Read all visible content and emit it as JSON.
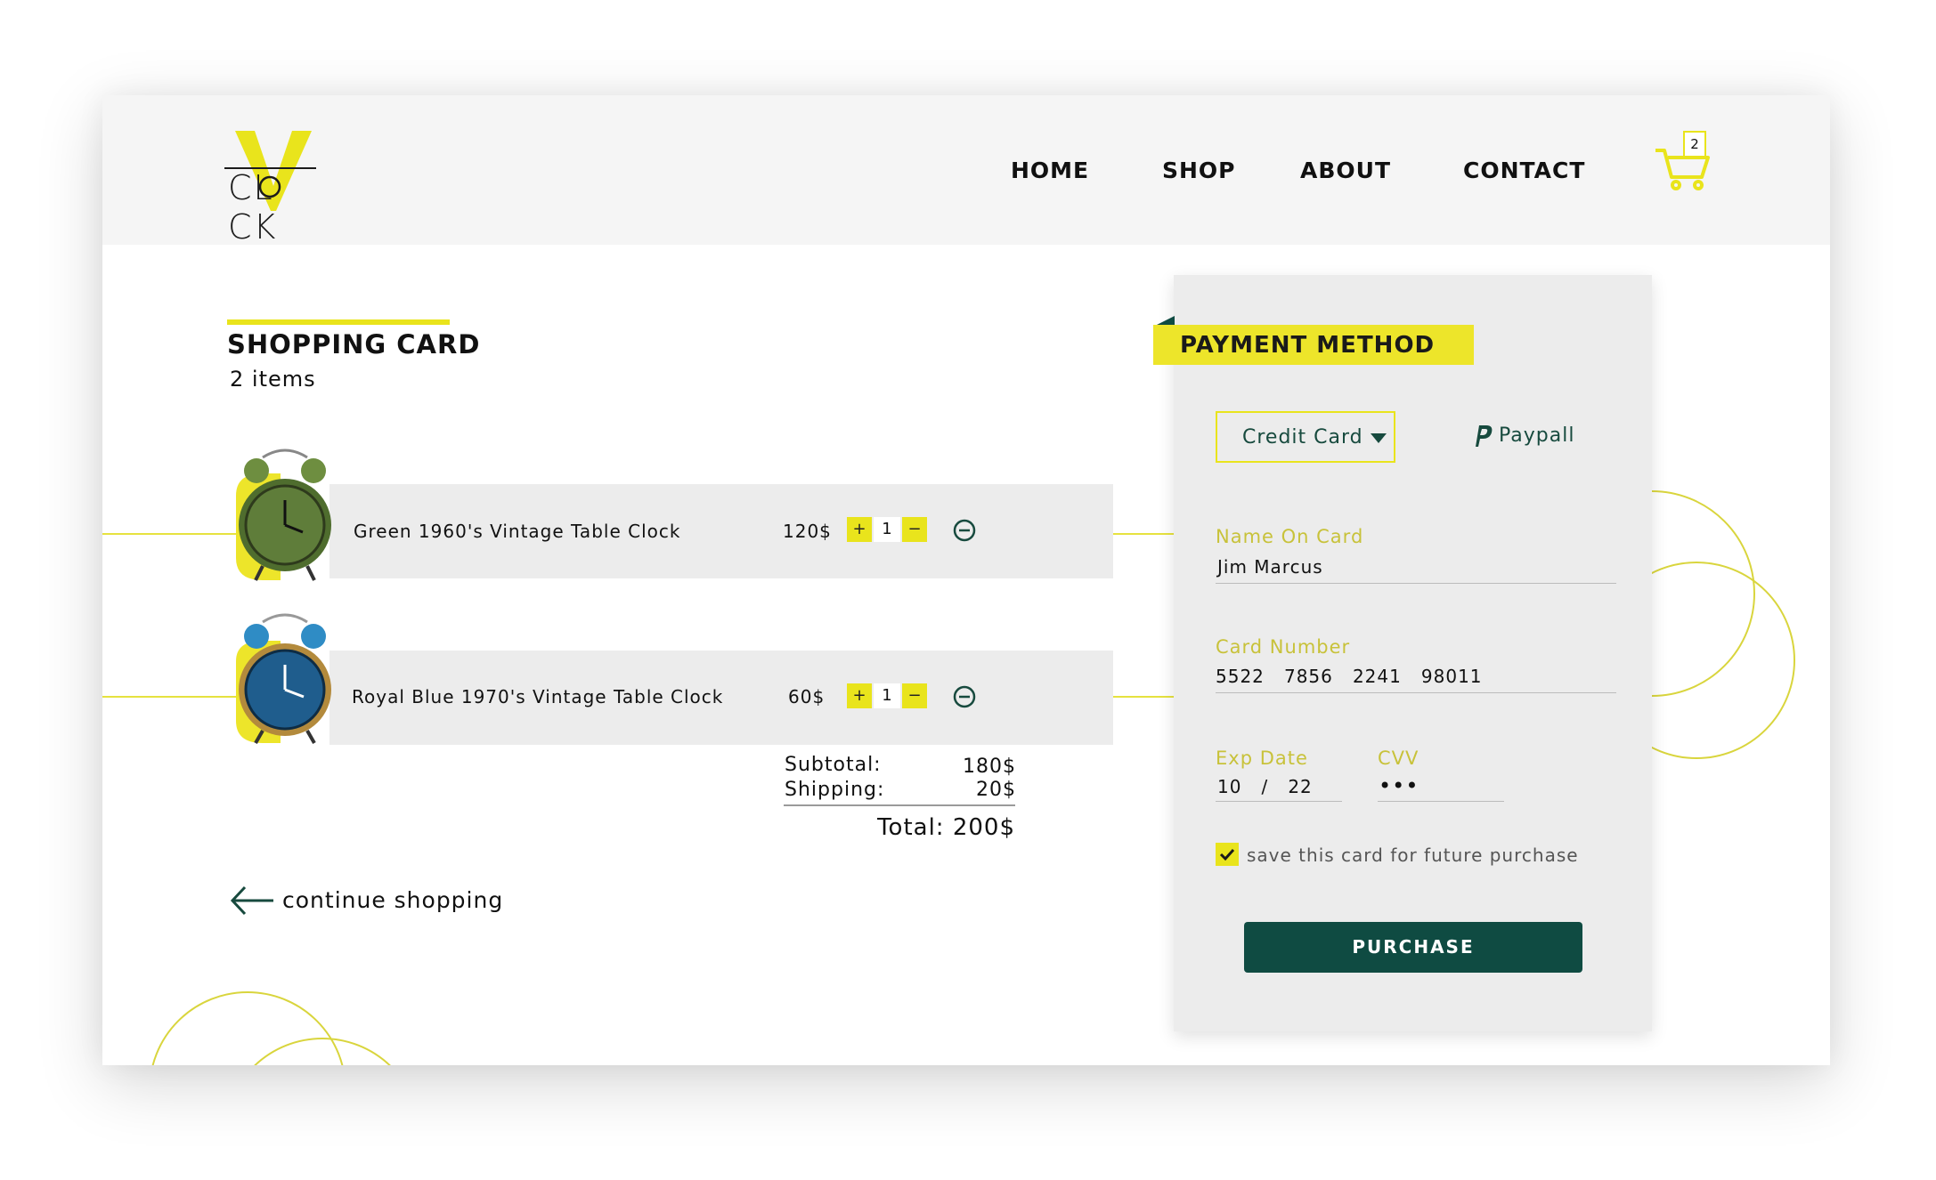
{
  "brand": {
    "logo_text": "CL    CK",
    "logo_letter": "V"
  },
  "nav": {
    "items": [
      "HOME",
      "SHOP",
      "ABOUT",
      "CONTACT"
    ]
  },
  "cart": {
    "count": "2"
  },
  "shopping": {
    "title": "SHOPPING CARD",
    "items_count": "2 items",
    "items": [
      {
        "name": "Green 1960's Vintage Table Clock",
        "price": "120$",
        "qty": "1",
        "plus": "+",
        "minus": "−",
        "clock_color": "#5f7d3a"
      },
      {
        "name": "Royal Blue 1970's Vintage Table Clock",
        "price": "60$",
        "qty": "1",
        "plus": "+",
        "minus": "−",
        "clock_color": "#1f5d8d"
      }
    ],
    "summary": {
      "subtotal_label": "Subtotal:",
      "subtotal_value": "180$",
      "shipping_label": "Shipping:",
      "shipping_value": "20$",
      "total": "Total: 200$"
    },
    "continue": "continue shopping"
  },
  "payment": {
    "title": "PAYMENT METHOD",
    "method_selected": "Credit Card",
    "alt_method": "Paypall",
    "name_label": "Name On Card",
    "name_value": "Jim Marcus",
    "number_label": "Card Number",
    "number_value": "5522   7856   2241   98011",
    "exp_label": "Exp Date",
    "exp_value": "10   /   22",
    "cvv_label": "CVV",
    "cvv_value": "•••",
    "save_label": "save this card for future purchase",
    "save_checked": true,
    "purchase_label": "PURCHASE"
  },
  "colors": {
    "accent": "#e9e41c",
    "dark_green": "#0f4b42",
    "label": "#c8c23a"
  }
}
